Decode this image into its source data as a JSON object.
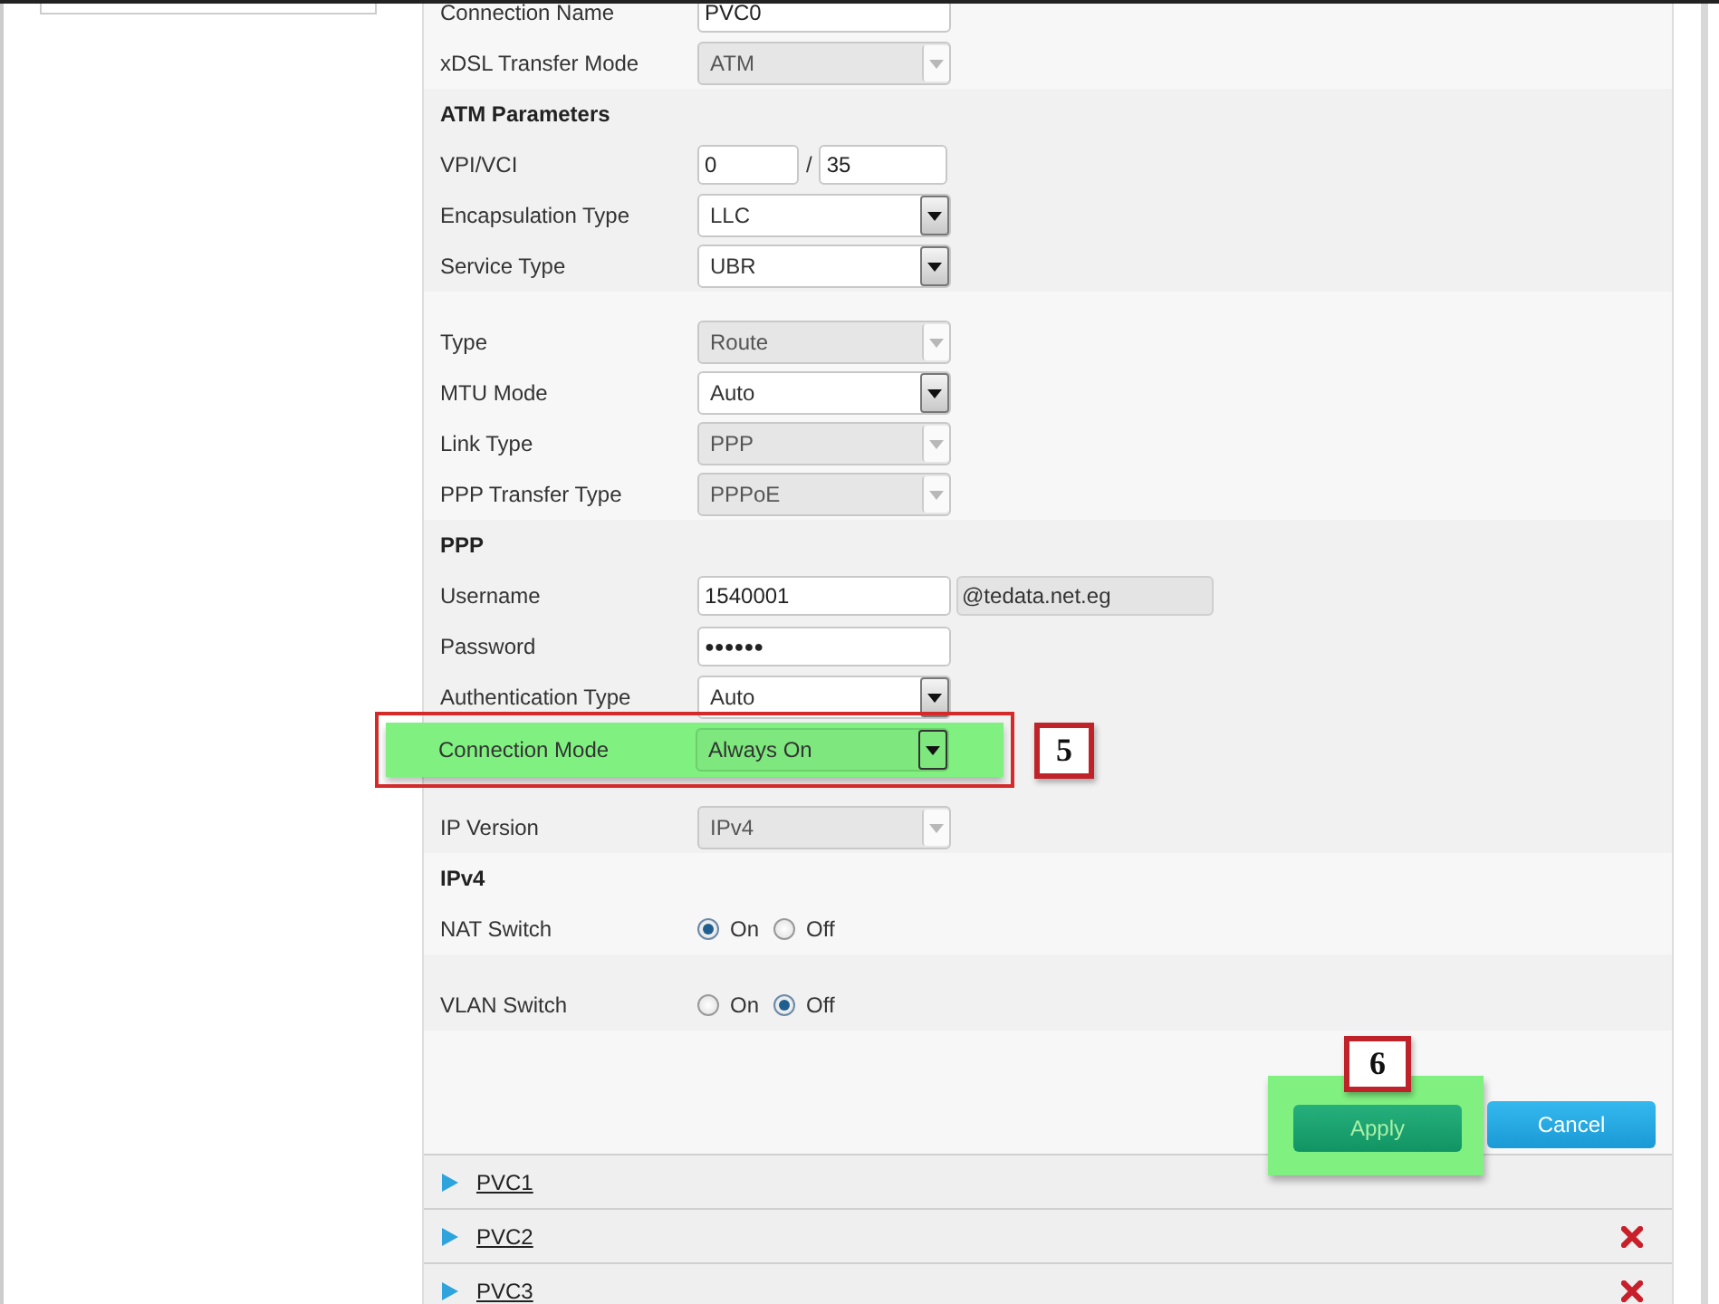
{
  "form": {
    "sections": [
      {
        "rows": [
          {
            "kind": "text",
            "label": "Connection Name",
            "value": "PVC0"
          },
          {
            "kind": "select",
            "label": "xDSL Transfer Mode",
            "value": "ATM",
            "disabled": true
          }
        ]
      },
      {
        "heading": "ATM Parameters",
        "rows": [
          {
            "kind": "pair",
            "label": "VPI/VCI",
            "value": "0",
            "separator": "/",
            "value2": "35"
          },
          {
            "kind": "select",
            "label": "Encapsulation Type",
            "value": "LLC",
            "disabled": false
          },
          {
            "kind": "select",
            "label": "Service Type",
            "value": "UBR",
            "disabled": false
          }
        ]
      },
      {
        "rows": [
          {
            "kind": "select",
            "label": "Type",
            "value": "Route",
            "disabled": true
          },
          {
            "kind": "select",
            "label": "MTU Mode",
            "value": "Auto",
            "disabled": false
          },
          {
            "kind": "select",
            "label": "Link Type",
            "value": "PPP",
            "disabled": true
          },
          {
            "kind": "select",
            "label": "PPP Transfer Type",
            "value": "PPPoE",
            "disabled": true
          }
        ]
      },
      {
        "heading": "PPP",
        "rows": [
          {
            "kind": "text",
            "label": "Username",
            "value": "1540001",
            "suffix": "@tedata.net.eg"
          },
          {
            "kind": "password",
            "label": "Password",
            "value": "●●●●●●"
          },
          {
            "kind": "select",
            "label": "Authentication Type",
            "value": "Auto",
            "disabled": false
          },
          {
            "kind": "select",
            "label": "Connection Mode",
            "value": "Always On",
            "disabled": false,
            "highlighted": true,
            "callout": "5"
          },
          {
            "kind": "select",
            "label": "IP Version",
            "value": "IPv4",
            "disabled": true
          }
        ]
      },
      {
        "heading": "IPv4",
        "rows": [
          {
            "kind": "radio",
            "label": "NAT Switch",
            "options": [
              {
                "label": "On",
                "selected": true
              },
              {
                "label": "Off",
                "selected": false
              }
            ]
          }
        ]
      },
      {
        "rows": [
          {
            "kind": "radio",
            "label": "VLAN Switch",
            "options": [
              {
                "label": "On",
                "selected": false
              },
              {
                "label": "Off",
                "selected": true
              }
            ]
          }
        ]
      }
    ],
    "buttons": [
      {
        "label": "Apply",
        "kind": "primary",
        "highlighted": true,
        "callout": "6"
      },
      {
        "label": "Cancel",
        "kind": "secondary",
        "highlighted": false
      }
    ]
  },
  "pvc_list": [
    {
      "label": "PVC1",
      "deletable": false
    },
    {
      "label": "PVC2",
      "deletable": true
    },
    {
      "label": "PVC3",
      "deletable": true
    }
  ]
}
